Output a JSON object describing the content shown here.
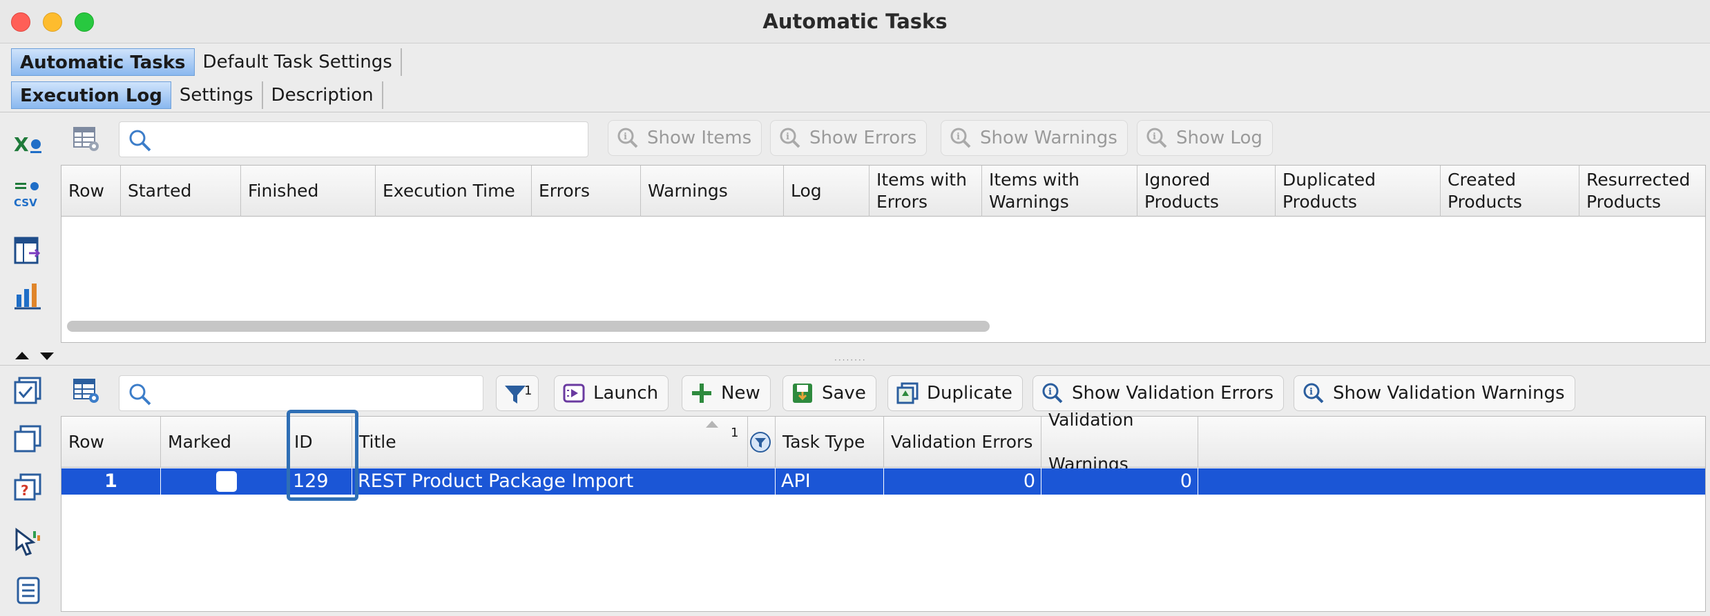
{
  "window": {
    "title": "Automatic Tasks"
  },
  "main_tabs": [
    "Automatic Tasks",
    "Default Task Settings"
  ],
  "sub_tabs": [
    "Execution Log",
    "Settings",
    "Description"
  ],
  "log_toolbar": {
    "search_placeholder": "",
    "buttons": [
      "Show Items",
      "Show Errors",
      "Show Warnings",
      "Show Log"
    ]
  },
  "log_table": {
    "columns": [
      [
        "Row"
      ],
      [
        "Started"
      ],
      [
        "Finished"
      ],
      [
        "Execution Time"
      ],
      [
        "Errors"
      ],
      [
        "Warnings"
      ],
      [
        "Log"
      ],
      [
        "Items with",
        "Errors"
      ],
      [
        "Items with",
        "Warnings"
      ],
      [
        "Ignored",
        "Products"
      ],
      [
        "Duplicated",
        "Products"
      ],
      [
        "Created",
        "Products"
      ],
      [
        "Resurrected",
        "Products"
      ]
    ],
    "rows": []
  },
  "task_toolbar": {
    "search_placeholder": "",
    "filter_count": "1",
    "buttons": [
      "Launch",
      "New",
      "Save",
      "Duplicate",
      "Show Validation Errors",
      "Show Validation Warnings"
    ]
  },
  "task_table": {
    "columns": [
      [
        "Row"
      ],
      [
        "Marked"
      ],
      [
        "ID"
      ],
      [
        "Title"
      ],
      [
        ""
      ],
      [
        "Task Type"
      ],
      [
        "Validation Errors"
      ],
      [
        "Validation",
        "Warnings"
      ]
    ],
    "sort_indicator": "1",
    "rows": [
      {
        "row": "1",
        "marked": false,
        "id": "129",
        "title": "REST Product Package Import",
        "task_type": "API",
        "validation_errors": "0",
        "validation_warnings": "0"
      }
    ]
  },
  "colors": {
    "selection": "#1b56d6",
    "active_tab": "#8ab8ef",
    "highlight": "#2f6fb5"
  }
}
